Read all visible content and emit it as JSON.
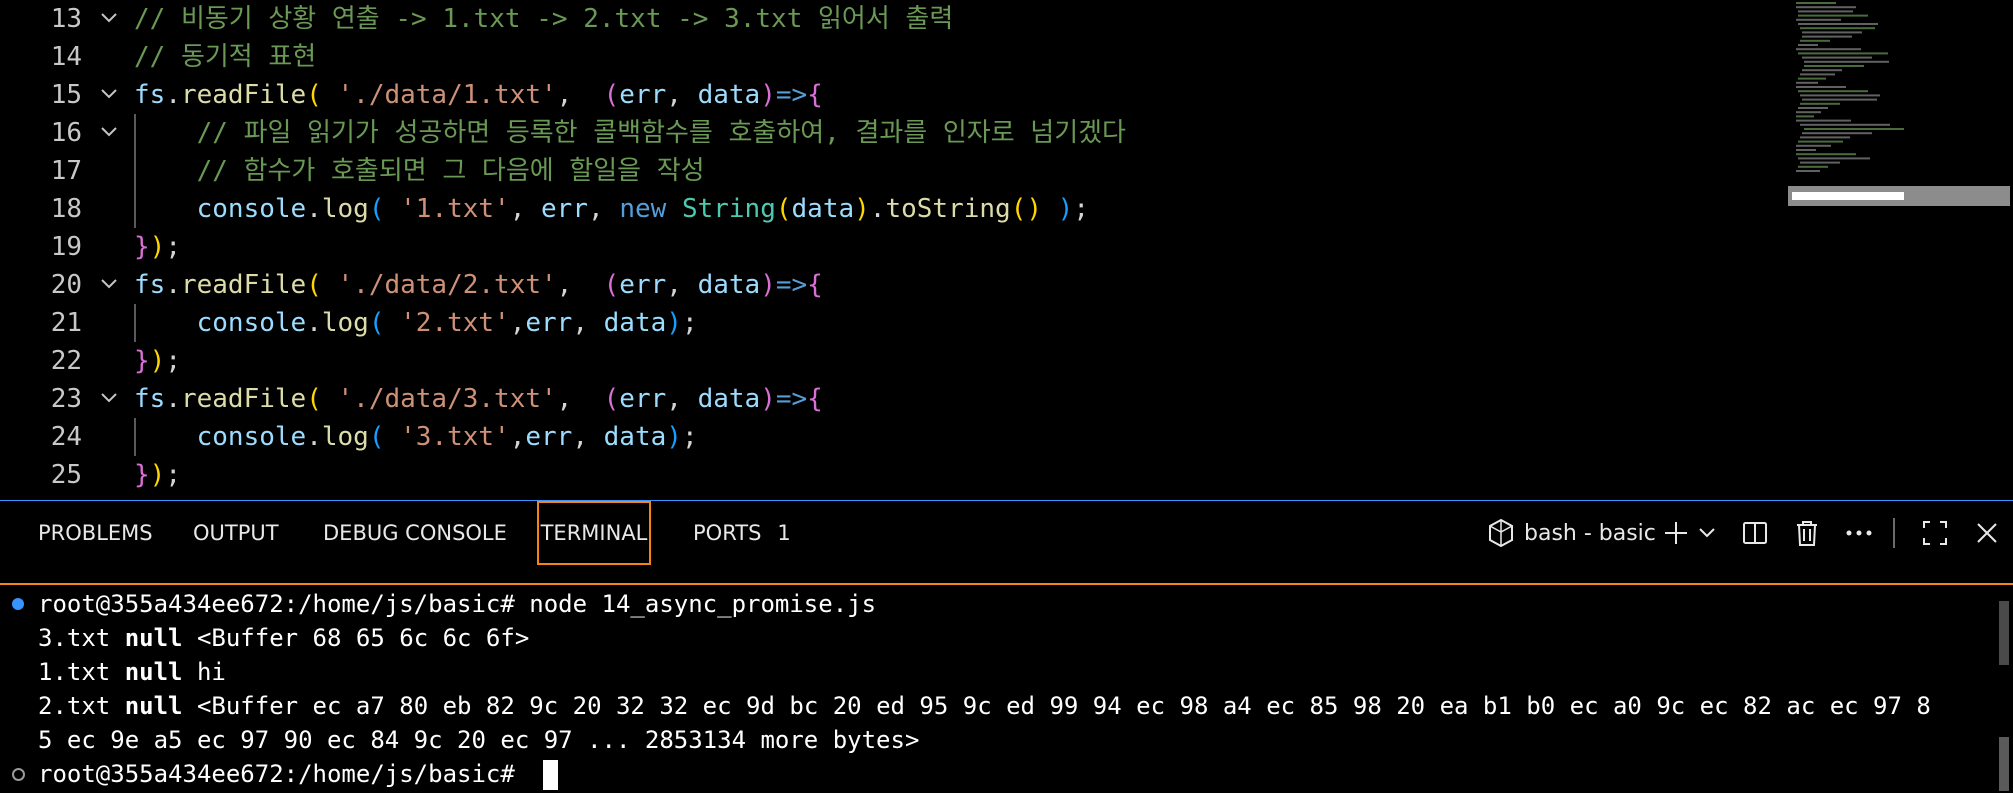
{
  "editor": {
    "lines": [
      {
        "num": "13",
        "fold": true,
        "guide": false,
        "tokens": [
          {
            "t": "// 비동기 상황 연출 -> 1.txt -> 2.txt -> 3.txt 읽어서 출력",
            "c": "cm"
          }
        ]
      },
      {
        "num": "14",
        "fold": false,
        "guide": false,
        "tokens": [
          {
            "t": "// 동기적 표현",
            "c": "cm"
          }
        ]
      },
      {
        "num": "15",
        "fold": true,
        "guide": false,
        "tokens": [
          {
            "t": "fs",
            "c": "id"
          },
          {
            "t": ".",
            "c": "pl"
          },
          {
            "t": "readFile",
            "c": "fn"
          },
          {
            "t": "( ",
            "c": "b1"
          },
          {
            "t": "'./data/1.txt'",
            "c": "st"
          },
          {
            "t": ",  ",
            "c": "pl"
          },
          {
            "t": "(",
            "c": "b2"
          },
          {
            "t": "err",
            "c": "id"
          },
          {
            "t": ", ",
            "c": "pl"
          },
          {
            "t": "data",
            "c": "id"
          },
          {
            "t": ")",
            "c": "b2"
          },
          {
            "t": "=>",
            "c": "ar"
          },
          {
            "t": "{",
            "c": "b2"
          }
        ]
      },
      {
        "num": "16",
        "fold": true,
        "guide": true,
        "tokens": [
          {
            "t": "    // 파일 읽기가 성공하면 등록한 콜백함수를 호출하여, 결과를 인자로 넘기겠다",
            "c": "cm"
          }
        ]
      },
      {
        "num": "17",
        "fold": false,
        "guide": true,
        "tokens": [
          {
            "t": "    // 함수가 호출되면 그 다음에 할일을 작성",
            "c": "cm"
          }
        ]
      },
      {
        "num": "18",
        "fold": false,
        "guide": true,
        "tokens": [
          {
            "t": "    ",
            "c": "pl"
          },
          {
            "t": "console",
            "c": "id"
          },
          {
            "t": ".",
            "c": "pl"
          },
          {
            "t": "log",
            "c": "fn"
          },
          {
            "t": "( ",
            "c": "b3"
          },
          {
            "t": "'1.txt'",
            "c": "st"
          },
          {
            "t": ", ",
            "c": "pl"
          },
          {
            "t": "err",
            "c": "id"
          },
          {
            "t": ", ",
            "c": "pl"
          },
          {
            "t": "new ",
            "c": "kw"
          },
          {
            "t": "String",
            "c": "ty"
          },
          {
            "t": "(",
            "c": "b1"
          },
          {
            "t": "data",
            "c": "id"
          },
          {
            "t": ")",
            "c": "b1"
          },
          {
            "t": ".",
            "c": "pl"
          },
          {
            "t": "toString",
            "c": "fn"
          },
          {
            "t": "()",
            "c": "b1"
          },
          {
            "t": " )",
            "c": "b3"
          },
          {
            "t": ";",
            "c": "pl"
          }
        ]
      },
      {
        "num": "19",
        "fold": false,
        "guide": false,
        "tokens": [
          {
            "t": "}",
            "c": "b2"
          },
          {
            "t": ")",
            "c": "b1"
          },
          {
            "t": ";",
            "c": "pl"
          }
        ]
      },
      {
        "num": "20",
        "fold": true,
        "guide": false,
        "tokens": [
          {
            "t": "fs",
            "c": "id"
          },
          {
            "t": ".",
            "c": "pl"
          },
          {
            "t": "readFile",
            "c": "fn"
          },
          {
            "t": "( ",
            "c": "b1"
          },
          {
            "t": "'./data/2.txt'",
            "c": "st"
          },
          {
            "t": ",  ",
            "c": "pl"
          },
          {
            "t": "(",
            "c": "b2"
          },
          {
            "t": "err",
            "c": "id"
          },
          {
            "t": ", ",
            "c": "pl"
          },
          {
            "t": "data",
            "c": "id"
          },
          {
            "t": ")",
            "c": "b2"
          },
          {
            "t": "=>",
            "c": "ar"
          },
          {
            "t": "{",
            "c": "b2"
          }
        ]
      },
      {
        "num": "21",
        "fold": false,
        "guide": true,
        "tokens": [
          {
            "t": "    ",
            "c": "pl"
          },
          {
            "t": "console",
            "c": "id"
          },
          {
            "t": ".",
            "c": "pl"
          },
          {
            "t": "log",
            "c": "fn"
          },
          {
            "t": "( ",
            "c": "b3"
          },
          {
            "t": "'2.txt'",
            "c": "st"
          },
          {
            "t": ",",
            "c": "pl"
          },
          {
            "t": "err",
            "c": "id"
          },
          {
            "t": ", ",
            "c": "pl"
          },
          {
            "t": "data",
            "c": "id"
          },
          {
            "t": ")",
            "c": "b3"
          },
          {
            "t": ";",
            "c": "pl"
          }
        ]
      },
      {
        "num": "22",
        "fold": false,
        "guide": false,
        "tokens": [
          {
            "t": "}",
            "c": "b2"
          },
          {
            "t": ")",
            "c": "b1"
          },
          {
            "t": ";",
            "c": "pl"
          }
        ]
      },
      {
        "num": "23",
        "fold": true,
        "guide": false,
        "tokens": [
          {
            "t": "fs",
            "c": "id"
          },
          {
            "t": ".",
            "c": "pl"
          },
          {
            "t": "readFile",
            "c": "fn"
          },
          {
            "t": "( ",
            "c": "b1"
          },
          {
            "t": "'./data/3.txt'",
            "c": "st"
          },
          {
            "t": ",  ",
            "c": "pl"
          },
          {
            "t": "(",
            "c": "b2"
          },
          {
            "t": "err",
            "c": "id"
          },
          {
            "t": ", ",
            "c": "pl"
          },
          {
            "t": "data",
            "c": "id"
          },
          {
            "t": ")",
            "c": "b2"
          },
          {
            "t": "=>",
            "c": "ar"
          },
          {
            "t": "{",
            "c": "b2"
          }
        ]
      },
      {
        "num": "24",
        "fold": false,
        "guide": true,
        "tokens": [
          {
            "t": "    ",
            "c": "pl"
          },
          {
            "t": "console",
            "c": "id"
          },
          {
            "t": ".",
            "c": "pl"
          },
          {
            "t": "log",
            "c": "fn"
          },
          {
            "t": "( ",
            "c": "b3"
          },
          {
            "t": "'3.txt'",
            "c": "st"
          },
          {
            "t": ",",
            "c": "pl"
          },
          {
            "t": "err",
            "c": "id"
          },
          {
            "t": ", ",
            "c": "pl"
          },
          {
            "t": "data",
            "c": "id"
          },
          {
            "t": ")",
            "c": "b3"
          },
          {
            "t": ";",
            "c": "pl"
          }
        ]
      },
      {
        "num": "25",
        "fold": false,
        "guide": false,
        "tokens": [
          {
            "t": "}",
            "c": "b2"
          },
          {
            "t": ")",
            "c": "b1"
          },
          {
            "t": ";",
            "c": "pl"
          }
        ]
      }
    ]
  },
  "panel": {
    "tabs": [
      {
        "label": "PROBLEMS",
        "active": false
      },
      {
        "label": "OUTPUT",
        "active": false
      },
      {
        "label": "DEBUG CONSOLE",
        "active": false
      },
      {
        "label": "TERMINAL",
        "active": true
      },
      {
        "label": "PORTS",
        "active": false,
        "badge": "1"
      }
    ],
    "terminal_name": "bash - basic",
    "actions": {
      "terminal_icon": "terminal-bash-icon",
      "add": "plus-icon",
      "dropdown": "chevron-down-icon",
      "split": "split-icon",
      "kill": "trash-icon",
      "more": "ellipsis-icon",
      "maximize": "maximize-icon",
      "close": "close-icon"
    }
  },
  "terminal": {
    "lines": [
      {
        "marker": "blue",
        "text": "root@355a434ee672:/home/js/basic# node 14_async_promise.js"
      },
      {
        "marker": "",
        "pre": "3.txt ",
        "bold": "null",
        "post": " <Buffer 68 65 6c 6c 6f>"
      },
      {
        "marker": "",
        "pre": "1.txt ",
        "bold": "null",
        "post": " hi"
      },
      {
        "marker": "",
        "pre": "2.txt ",
        "bold": "null",
        "post": " <Buffer ec a7 80 eb 82 9c 20 32 32 ec 9d bc 20 ed 95 9c ed 99 94 ec 98 a4 ec 85 98 20 ea b1 b0 ec a0 9c ec 82 ac ec 97 8"
      },
      {
        "marker": "",
        "text": "5 ec 9e a5 ec 97 90 ec 84 9c 20 ec 97 ... 2853134 more bytes>"
      },
      {
        "marker": "gray",
        "text": "root@355a434ee672:/home/js/basic# ",
        "cursor": true
      }
    ]
  },
  "colors": {
    "accent": "#3794ff",
    "active_tab_border": "#f38518",
    "comment": "#6a9955",
    "string": "#ce9178"
  }
}
